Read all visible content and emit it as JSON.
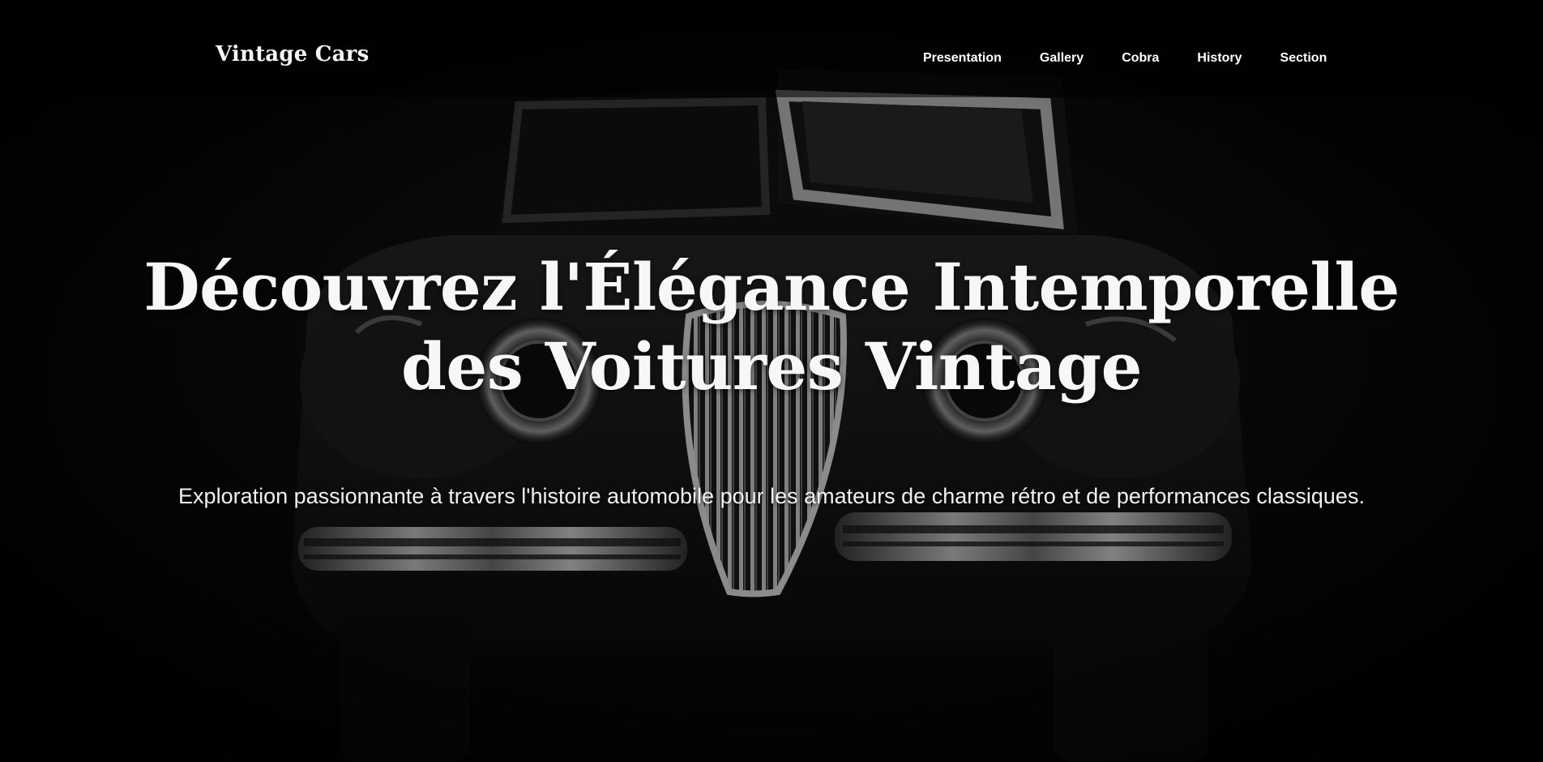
{
  "header": {
    "logo": "Vintage Cars",
    "nav": [
      "Presentation",
      "Gallery",
      "Cobra",
      "History",
      "Section"
    ]
  },
  "hero": {
    "title": "Découvrez l'Élégance Intemporelle des Voitures Vintage",
    "subtitle": "Exploration passionnante à travers l'histoire automobile pour les amateurs de charme rétro et de performances classiques."
  },
  "colors": {
    "background": "#050505",
    "text": "#ffffff"
  }
}
